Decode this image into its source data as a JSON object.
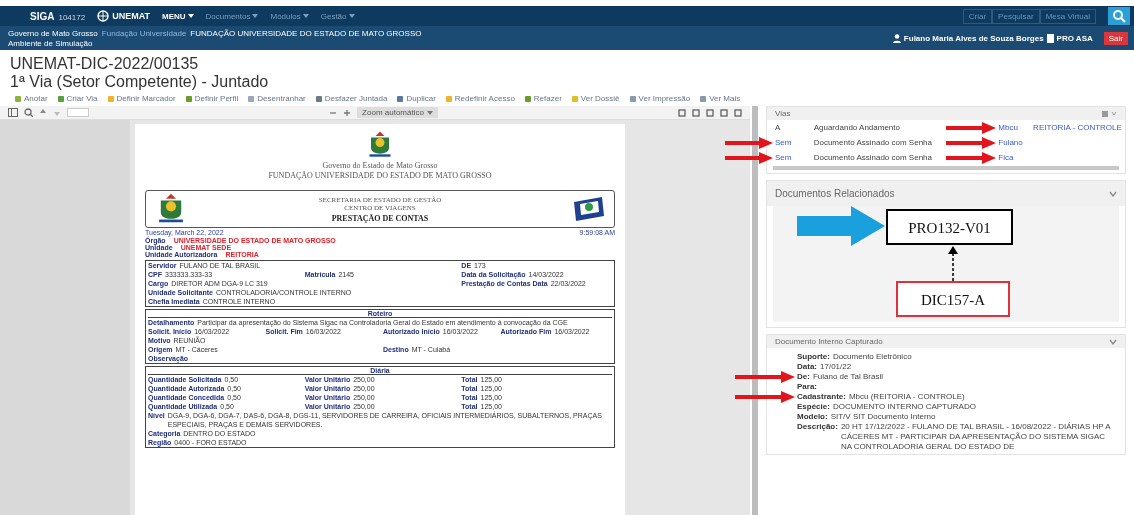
{
  "navbar": {
    "brand": "SIGA",
    "version": "104172",
    "logo_text": "UNEMAT",
    "menus": [
      {
        "label": "MENU",
        "strong": true
      },
      {
        "label": "Documentos",
        "strong": false
      },
      {
        "label": "Módulos",
        "strong": false
      },
      {
        "label": "Gestão",
        "strong": false
      }
    ],
    "actions": [
      "Criar",
      "Pesquisar",
      "Mesa Virtual"
    ]
  },
  "breadcrumb": {
    "org": "Governo de Mato Grosso",
    "link": "Fundação Universidade",
    "unit": "FUNDAÇÃO UNIVERSIDADE DO ESTADO DE MATO GROSSO",
    "env": "Ambiente de Simulação",
    "user": "Fulano Maria Alves de Souza Borges",
    "lotation": "PRO ASA",
    "logout": "Sair"
  },
  "document": {
    "code": "UNEMAT-DIC-2022/00135",
    "subtitle": "1ª Via (Setor Competente) - Juntado"
  },
  "toolbar": [
    "Anotar",
    "Criar Via",
    "Definir Marcador",
    "Definir Perfil",
    "Desentranhar",
    "Desfazer Juntada",
    "Duplicar",
    "Redefinir Acesso",
    "Refazer",
    "Ver Dossiê",
    "Ver Impressão",
    "Ver Mais"
  ],
  "viewer": {
    "zoom": "Zoom automático"
  },
  "pdf_page": {
    "gov_lines": [
      "Governo do Estado de Mato Grosso",
      "FUNDAÇÃO UNIVERSIDADE DO ESTADO DE MATO GROSSO"
    ],
    "header_lines": [
      "SECRETARIA DE ESTADO DE GESTÃO",
      "CENTRO DE VIAGENS"
    ],
    "form_title": "PRESTAÇÃO DE CONTAS",
    "date": "Tuesday, March 22, 2022",
    "time": "9:59:08 AM",
    "org": [
      {
        "label": "Órgão",
        "value": "UNIVERSIDADE DO ESTADO DE MATO GROSSO"
      },
      {
        "label": "Unidade",
        "value": "UNEMAT SEDE"
      },
      {
        "label": "Unidade Autorizadora",
        "value": "REITORIA"
      }
    ],
    "sections": [
      {
        "rows": [
          [
            {
              "label": "Servidor",
              "value": "FULANO DE TAL BRASIL"
            },
            null,
            {
              "label": "DE",
              "value": "173"
            }
          ],
          [
            {
              "label": "CPF",
              "value": "333333.333-33"
            },
            {
              "label": "Matrícula",
              "value": "2145"
            },
            {
              "label": "Data da Solicitação",
              "value": "14/03/2022"
            }
          ],
          [
            {
              "label": "Cargo",
              "value": "DIRETOR ADM DGA-9 LC 319"
            },
            null,
            {
              "label": "Prestação de Contas Data",
              "value": "22/03/2022"
            }
          ],
          [
            {
              "label": "Unidade Solicitante",
              "value": "CONTROLADORIA/CONTROLE INTERNO"
            }
          ],
          [
            {
              "label": "Chefia Imediata",
              "value": "CONTROLE INTERNO"
            }
          ]
        ]
      },
      {
        "title": "Roteiro",
        "rows": [
          [
            {
              "label": "Detalhamento",
              "value": "Participar da apresentação do Sistema Sigac na Controladoria Geral do Estado em atendimento à convocação da CGE"
            }
          ],
          [
            {
              "label": "Solicit. Início",
              "value": "16/03/2022"
            },
            {
              "label": "Solicit. Fim",
              "value": "16/03/2022"
            },
            {
              "label": "Autorizado Início",
              "value": "16/03/2022"
            },
            {
              "label": "Autorizado Fim",
              "value": "16/03/2022"
            }
          ],
          [
            {
              "label": "Motivo",
              "value": "REUNIÃO"
            }
          ],
          [
            {
              "label": "Origem",
              "value": "MT - Cáceres"
            },
            null,
            {
              "label": "Destino",
              "value": "MT - Cuiabá"
            }
          ],
          [
            {
              "label": "Observação"
            }
          ]
        ]
      },
      {
        "title": "Diária",
        "rows": [
          [
            {
              "label": "Quantidade Solicitada",
              "value": "0,50"
            },
            {
              "label": "Valor Unitário",
              "value": "250,00"
            },
            {
              "label": "Total",
              "value": "125,00"
            }
          ],
          [
            {
              "label": "Quantidade Autorizada",
              "value": "0,50"
            },
            {
              "label": "Valor Unitário",
              "value": "250,00"
            },
            {
              "label": "Total",
              "value": "125,00"
            }
          ],
          [
            {
              "label": "Quantidade Concedida",
              "value": "0,50"
            },
            {
              "label": "Valor Unitário",
              "value": "250,00"
            },
            {
              "label": "Total",
              "value": "125,00"
            }
          ],
          [
            {
              "label": "Quantidade Utilizada",
              "value": "0,50"
            },
            {
              "label": "Valor Unitário",
              "value": "250,00"
            },
            {
              "label": "Total",
              "value": "125,00"
            }
          ],
          [
            {
              "label": "Nível",
              "value": "DGA-9, DGA-6, DGA-7, DAS-6, DGA-8, DGS-11, SERVIDORES DE CARREIRA, OFICIAIS INTERMEDIÁRIOS, SUBALTERNOS, PRAÇAS ESPECIAIS, PRAÇAS E DEMAIS SERVIDORES."
            }
          ],
          [
            {
              "label": "Categoria",
              "value": "DENTRO DO ESTADO"
            }
          ],
          [
            {
              "label": "Região",
              "value": "0400 - FORO ESTADO"
            }
          ]
        ]
      }
    ]
  },
  "vias_panel": {
    "title": "Vias",
    "rows": [
      {
        "column_1": "A",
        "column_2": "Aguardando Andamento",
        "column_3": "Mbcu",
        "column_4": "REITORIA - CONTROLE"
      },
      {
        "column_1": "Sem",
        "column_2": "Documento Assinado com Senha",
        "column_3": "Fulano"
      },
      {
        "column_1": "Sem",
        "column_2": "Documento Assinado com Senha",
        "column_3": "Fica"
      }
    ]
  },
  "related_panel": {
    "title": "Documentos Relacionados",
    "nodes": [
      {
        "label": "PRO132-V01",
        "color": "#000000"
      },
      {
        "label": "DIC157-A",
        "color": "#e0303a"
      }
    ]
  },
  "info_panel": {
    "title": "Documento Interno Capturado",
    "fields": [
      {
        "label": "Suporte:",
        "value": "Documento Eletrônico"
      },
      {
        "label": "Data:",
        "value": "17/01/22"
      },
      {
        "label": "De:",
        "value": "Fulano de Tal Brasil"
      },
      {
        "label": "Para:"
      },
      {
        "label": "Cadastrante:",
        "value": "Mbcu (REITORIA - CONTROLE)"
      },
      {
        "label": "Espécie:",
        "value": "DOCUMENTO INTERNO CAPTURADO"
      },
      {
        "label": "Modelo:",
        "value": "SIT/V SIT Documento Interno"
      },
      {
        "label": "Descrição:",
        "value": "20 HT 17/12/2022 - FULANO DE TAL BRASIL - 16/08/2022 - DIÁRIAS HP A CÁCERES MT - PARTICIPAR DA APRESENTAÇÃO DO SISTEMA SIGAC NA CONTROLADORIA GERAL DO ESTADO DE"
      }
    ]
  }
}
